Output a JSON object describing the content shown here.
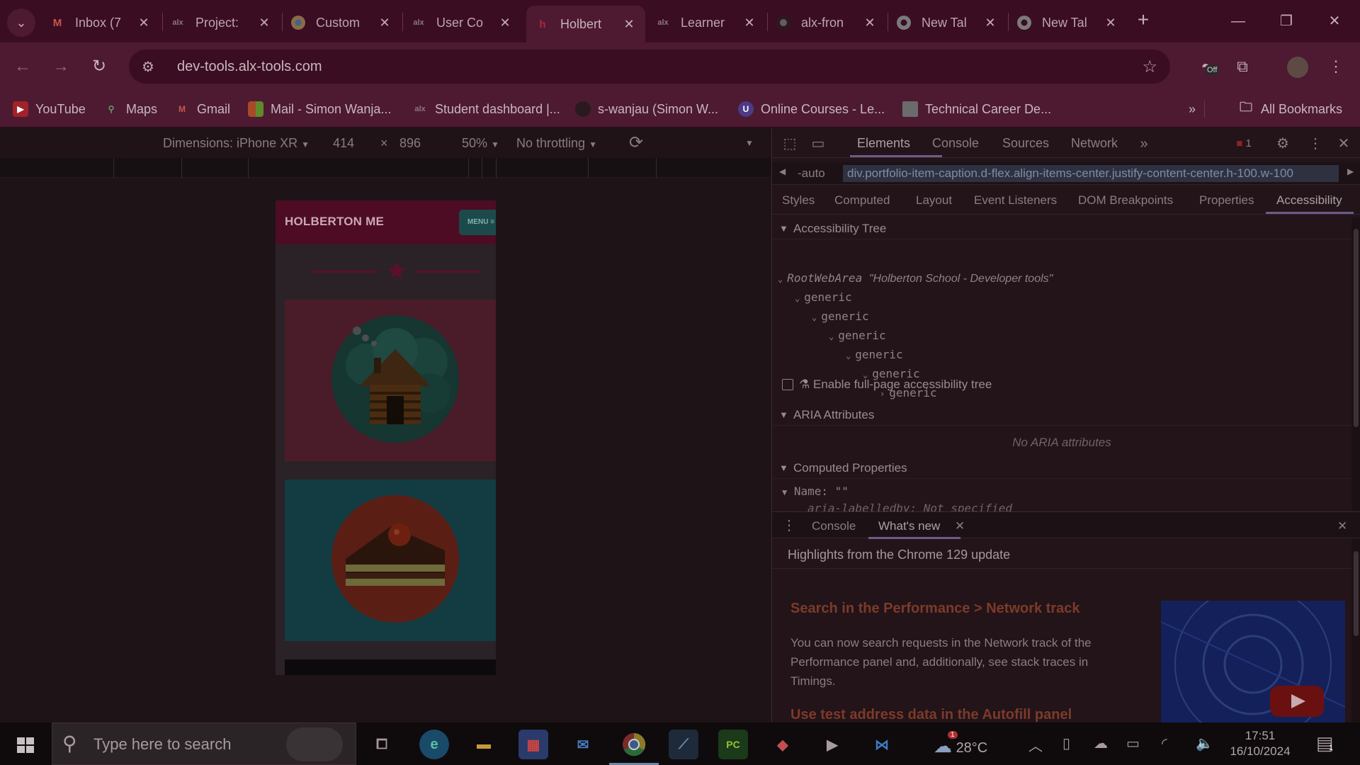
{
  "tabs": [
    {
      "label": "Inbox (7",
      "icon": "gmail-icon"
    },
    {
      "label": "Project:",
      "icon": "alx-icon"
    },
    {
      "label": "Custom",
      "icon": "chrome-icon"
    },
    {
      "label": "User Co",
      "icon": "alx-icon"
    },
    {
      "label": "Holbert",
      "icon": "holberton-icon",
      "active": true
    },
    {
      "label": "Learner",
      "icon": "alx-icon"
    },
    {
      "label": "alx-fron",
      "icon": "github-icon"
    },
    {
      "label": "New Tal",
      "icon": "chrome-icon"
    },
    {
      "label": "New Tal",
      "icon": "chrome-icon"
    }
  ],
  "toolbar": {
    "url": "dev-tools.alx-tools.com",
    "extension_badge": "Off"
  },
  "bookmarks": [
    {
      "label": "YouTube",
      "icon": "youtube-icon",
      "color": "#c4302b"
    },
    {
      "label": "Maps",
      "icon": "maps-icon",
      "color": "#2f7d3c"
    },
    {
      "label": "Gmail",
      "icon": "gmail-icon",
      "color": "#b23121"
    },
    {
      "label": "Mail - Simon Wanja...",
      "icon": "microsoft-icon",
      "color": "#b7661b"
    },
    {
      "label": "Student dashboard |...",
      "icon": "alx-icon",
      "color": "#3a0d22"
    },
    {
      "label": "s-wanjau (Simon W...",
      "icon": "github-icon",
      "color": "#2b1b22"
    },
    {
      "label": "Online Courses - Le...",
      "icon": "udemy-icon",
      "color": "#5a34a8"
    },
    {
      "label": "Technical Career De...",
      "icon": "site-icon",
      "color": "#5b5b5b"
    }
  ],
  "all_bookmarks": "All Bookmarks",
  "device_bar": {
    "dimensions": "Dimensions: iPhone XR",
    "width": "414",
    "times": "×",
    "height": "896",
    "zoom": "50%",
    "throttling": "No throttling"
  },
  "phone": {
    "title": "HOLBERTON ME",
    "menu": "MENU ≡"
  },
  "devtools": {
    "tabs": [
      "Elements",
      "Console",
      "Sources",
      "Network"
    ],
    "error_count": "1",
    "crumb_left": "-auto",
    "crumb_selected": "div.portfolio-item-caption.d-flex.align-items-center.justify-content-center.h-100.w-100",
    "subtabs": [
      "Styles",
      "Computed",
      "Layout",
      "Event Listeners",
      "DOM Breakpoints",
      "Properties",
      "Accessibility"
    ],
    "accessibility_tree_title": "Accessibility Tree",
    "enable_full_page": "Enable full-page accessibility tree",
    "root_role": "RootWebArea",
    "root_name": "\"Holberton School - Developer tools\"",
    "tree_nodes": [
      "generic",
      "generic",
      "generic",
      "generic",
      "generic",
      "generic"
    ],
    "aria_title": "ARIA Attributes",
    "no_aria": "No ARIA attributes",
    "computed_title": "Computed Properties",
    "name_line": "Name: \"\"",
    "labelledby": "aria-labelledby: Not specified"
  },
  "drawer": {
    "tabs": [
      "Console",
      "What's new"
    ],
    "highlights": "Highlights from the Chrome 129 update",
    "heading1": "Search in the Performance > Network track",
    "paragraph1": "You can now search requests in the Network track of the Performance panel and, additionally, see stack traces in Timings.",
    "heading2": "Use test address data in the Autofill panel"
  },
  "taskbar": {
    "search_placeholder": "Type here to search",
    "weather": "28°C",
    "weather_alert": "1",
    "time": "17:51",
    "date": "16/10/2024",
    "notification_count": "1"
  }
}
